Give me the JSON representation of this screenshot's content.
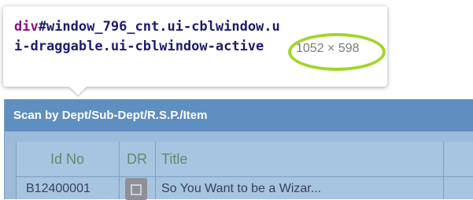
{
  "window": {
    "title": "Scan by Dept/Sub-Dept/R.S.P./Item"
  },
  "grid": {
    "columns": [
      "Id No",
      "DR",
      "Title",
      ""
    ],
    "rows": [
      {
        "id": "B12400001",
        "dr_icon": "document-icon",
        "title": "So You Want to be a Wizar..."
      }
    ]
  },
  "tooltip": {
    "tag": "div",
    "selector_rest": "#window_796_cnt.ui-cblwindow.ui-draggable.ui-cblwindow-active",
    "dimensions": "1052 × 598"
  },
  "colors": {
    "titlebar": "#5f8fc0",
    "grid_bg": "#a7c4e0",
    "header_text": "#5f8c6a",
    "highlight": "#a4d42a",
    "tag_color": "#881280",
    "selector_color": "#1f1b6e"
  }
}
